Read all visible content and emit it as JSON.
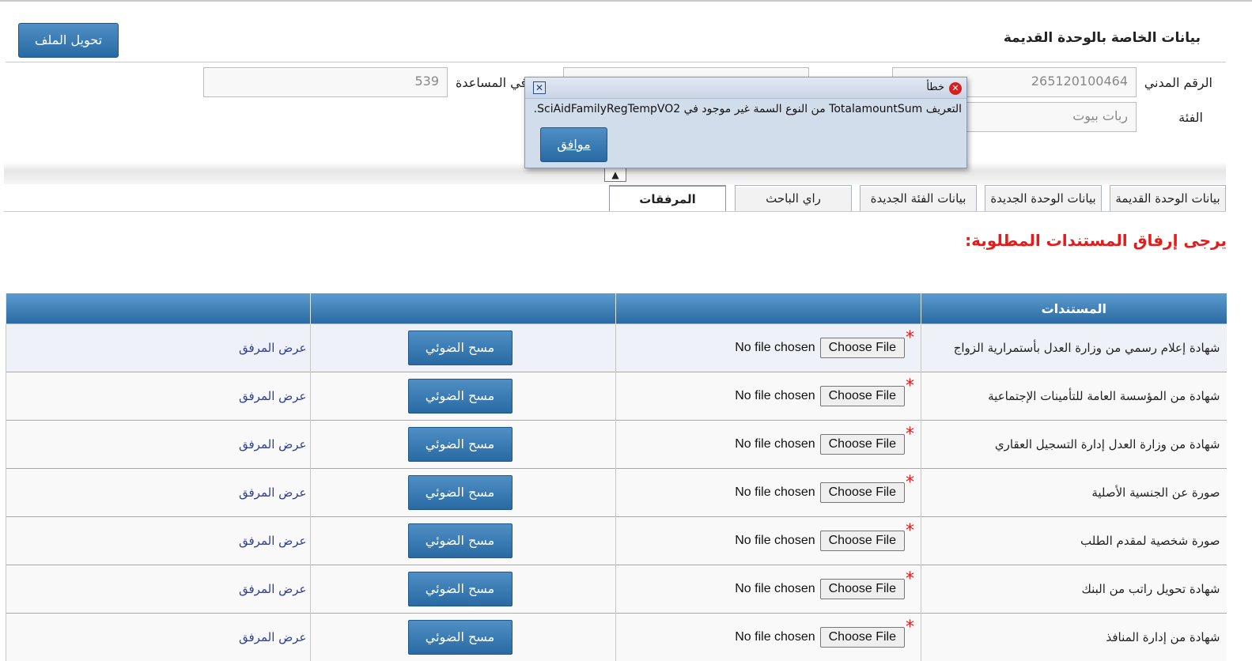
{
  "header": {
    "section_title": "بيانات الخاصة بالوحدة القديمة",
    "transfer_button": "تحويل الملف"
  },
  "form": {
    "civil_id_label": "الرقم المدني",
    "civil_id_value": "265120100464",
    "category_label": "الفئة",
    "category_value": "ربات بيوت",
    "assistance_label": "في المساعدة",
    "assistance_value": "539"
  },
  "dialog": {
    "title": "خطأ",
    "message": "التعريف TotalamountSum من النوع السمة غير موجود في SciAidFamilyRegTempVO2.",
    "ok_button": "موافق",
    "close_glyph": "✕",
    "error_glyph": "✕"
  },
  "tabs": [
    {
      "label": "بيانات الوحدة القديمة",
      "active": false
    },
    {
      "label": "بيانات الوحدة الجديدة",
      "active": false
    },
    {
      "label": "بيانات الفئة الجديدة",
      "active": false
    },
    {
      "label": "راي الباحث",
      "active": false
    },
    {
      "label": "المرفقات",
      "active": true
    }
  ],
  "scroll_arrow": "▲",
  "attachments_heading": "يرجى إرفاق المستندات المطلوبة:",
  "table": {
    "headers": [
      "المستندات",
      "",
      "",
      ""
    ],
    "choose_file_label": "Choose File",
    "no_file_label": "No file chosen",
    "scan_label": "مسح الضوئي",
    "view_label": "عرض المرفق",
    "required_mark": "*",
    "rows": [
      "شهادة إعلام رسمي من وزارة العدل بأستمرارية الزواج",
      "شهادة من المؤسسة العامة للتأمينات الإجتماعية",
      "شهادة من وزارة العدل إدارة التسجيل العقاري",
      "صورة عن الجنسية الأصلية",
      "صورة شخصية لمقدم الطلب",
      "شهادة تحويل راتب من البنك",
      "شهادة من إدارة المنافذ"
    ]
  },
  "colors": {
    "primary_button": "#2a6aa4",
    "error_heading": "#e31b1b",
    "link": "#2c3f95",
    "active_tab_accent": "#c0262d"
  }
}
